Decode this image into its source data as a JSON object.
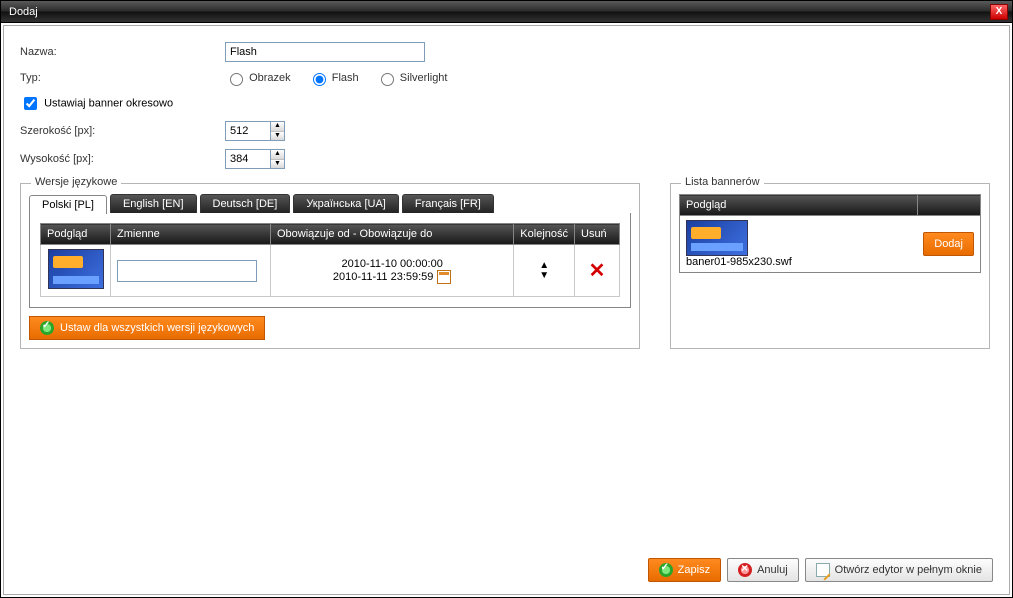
{
  "window": {
    "title": "Dodaj"
  },
  "form": {
    "name_label": "Nazwa:",
    "name_value": "Flash",
    "type_label": "Typ:",
    "type_options": {
      "image": "Obrazek",
      "flash": "Flash",
      "silverlight": "Silverlight"
    },
    "type_selected": "flash",
    "periodic_label": "Ustawiaj banner okresowo",
    "periodic_checked": true,
    "width_label": "Szerokość [px]:",
    "width_value": "512",
    "height_label": "Wysokość [px]:",
    "height_value": "384"
  },
  "lang_section": {
    "legend": "Wersje językowe",
    "tabs": [
      {
        "label": "Polski [PL]",
        "active": true
      },
      {
        "label": "English [EN]"
      },
      {
        "label": "Deutsch [DE]"
      },
      {
        "label": "Українська [UA]"
      },
      {
        "label": "Français [FR]"
      }
    ],
    "columns": {
      "preview": "Podgląd",
      "variables": "Zmienne",
      "validity": "Obowiązuje od - Obowiązuje do",
      "order": "Kolejność",
      "delete": "Usuń"
    },
    "row": {
      "from": "2010-11-10 00:00:00",
      "to": "2010-11-11 23:59:59"
    },
    "set_all_label": "Ustaw dla wszystkich wersji językowych"
  },
  "banner_list": {
    "legend": "Lista bannerów",
    "preview_header": "Podgląd",
    "add_label": "Dodaj",
    "filename": "baner01-985x230.swf"
  },
  "footer": {
    "save": "Zapisz",
    "cancel": "Anuluj",
    "open_editor": "Otwórz edytor w pełnym oknie"
  }
}
